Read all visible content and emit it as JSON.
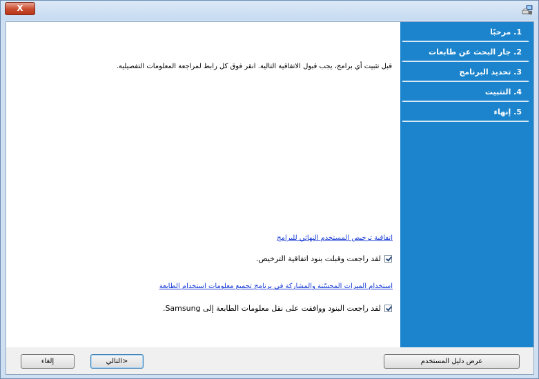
{
  "window": {
    "close_label": "X",
    "app_icon": "printer-computer-icon"
  },
  "sidebar": {
    "steps": [
      {
        "label": "1. مرحبًا"
      },
      {
        "label": "2. جار البحث عن طابعات"
      },
      {
        "label": "3. تحديد البرنامج"
      },
      {
        "label": "4. التثبيت"
      },
      {
        "label": "5. إنهاء"
      }
    ]
  },
  "content": {
    "intro": "قبل تثبيت أي برامج، يجب قبول الاتفاقية التالية. انقر فوق كل رابط لمراجعة المعلومات التفصيلية.",
    "license_link": "اتفاقية ترخيص المستخدم النهائي للبرامج",
    "license_check": "لقد راجعت وقبلت بنود اتفاقية الترخيص.",
    "sharing_link": "استخدام الميزات المحسّنة والمشاركة في برنامج تجميع معلومات استخدام الطابعة",
    "sharing_check": "لقد راجعت البنود ووافقت على نقل معلومات الطابعة إلى Samsung."
  },
  "buttons": {
    "user_guide": "عرض دليل المستخدم",
    "next": "التالي>",
    "cancel": "إلغاء"
  }
}
